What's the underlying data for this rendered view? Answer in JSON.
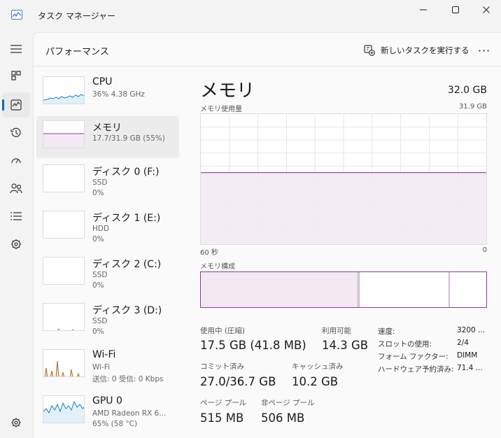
{
  "app": {
    "title": "タスク マネージャー"
  },
  "header": {
    "title": "パフォーマンス",
    "run_task_label": "新しいタスクを実行する",
    "more_label": "···"
  },
  "devices": [
    {
      "name": "CPU",
      "sub1": "36%  4.38 GHz",
      "sub2": ""
    },
    {
      "name": "メモリ",
      "sub1": "17.7/31.9 GB (55%)",
      "sub2": ""
    },
    {
      "name": "ディスク 0 (F:)",
      "sub1": "SSD",
      "sub2": "0%"
    },
    {
      "name": "ディスク 1 (E:)",
      "sub1": "HDD",
      "sub2": "0%"
    },
    {
      "name": "ディスク 2 (C:)",
      "sub1": "SSD",
      "sub2": "0%"
    },
    {
      "name": "ディスク 3 (D:)",
      "sub1": "SSD",
      "sub2": "0%"
    },
    {
      "name": "Wi-Fi",
      "sub1": "Wi-Fi",
      "sub2": "送信: 0 受信: 0 Kbps"
    },
    {
      "name": "GPU 0",
      "sub1": "AMD Radeon RX 6...",
      "sub2": "65%  (58 °C)"
    }
  ],
  "memory": {
    "title": "メモリ",
    "total": "32.0 GB",
    "usage_label": "メモリ使用量",
    "usage_max": "31.9 GB",
    "axis_left": "60 秒",
    "axis_right": "0",
    "composition_label": "メモリ構成",
    "usage_fraction": 0.55,
    "composition_fractions": {
      "in_use": 0.55,
      "modified": 0.005,
      "standby": 0.315
    },
    "stats": {
      "in_use_label": "使用中 (圧縮)",
      "in_use_value": "17.5 GB (41.8 MB)",
      "available_label": "利用可能",
      "available_value": "14.3 GB",
      "committed_label": "コミット済み",
      "committed_value": "27.0/36.7 GB",
      "cached_label": "キャッシュ済み",
      "cached_value": "10.2 GB",
      "paged_label": "ページ プール",
      "paged_value": "515 MB",
      "nonpaged_label": "非ページ プール",
      "nonpaged_value": "506 MB"
    },
    "specs": {
      "speed_label": "速度:",
      "speed_value": "3200 ...",
      "slots_label": "スロットの使用:",
      "slots_value": "2/4",
      "form_label": "フォーム ファクター:",
      "form_value": "DIMM",
      "reserved_label": "ハードウェア予約済み:",
      "reserved_value": "71.4 ..."
    }
  },
  "colors": {
    "memory_line": "#8b3a9a",
    "memory_fill": "#f2e9f3",
    "cpu_line": "#1b7fc2",
    "cpu_fill": "#e3f0fa",
    "wifi_line": "#a56a1f",
    "accent": "#0067c0"
  }
}
